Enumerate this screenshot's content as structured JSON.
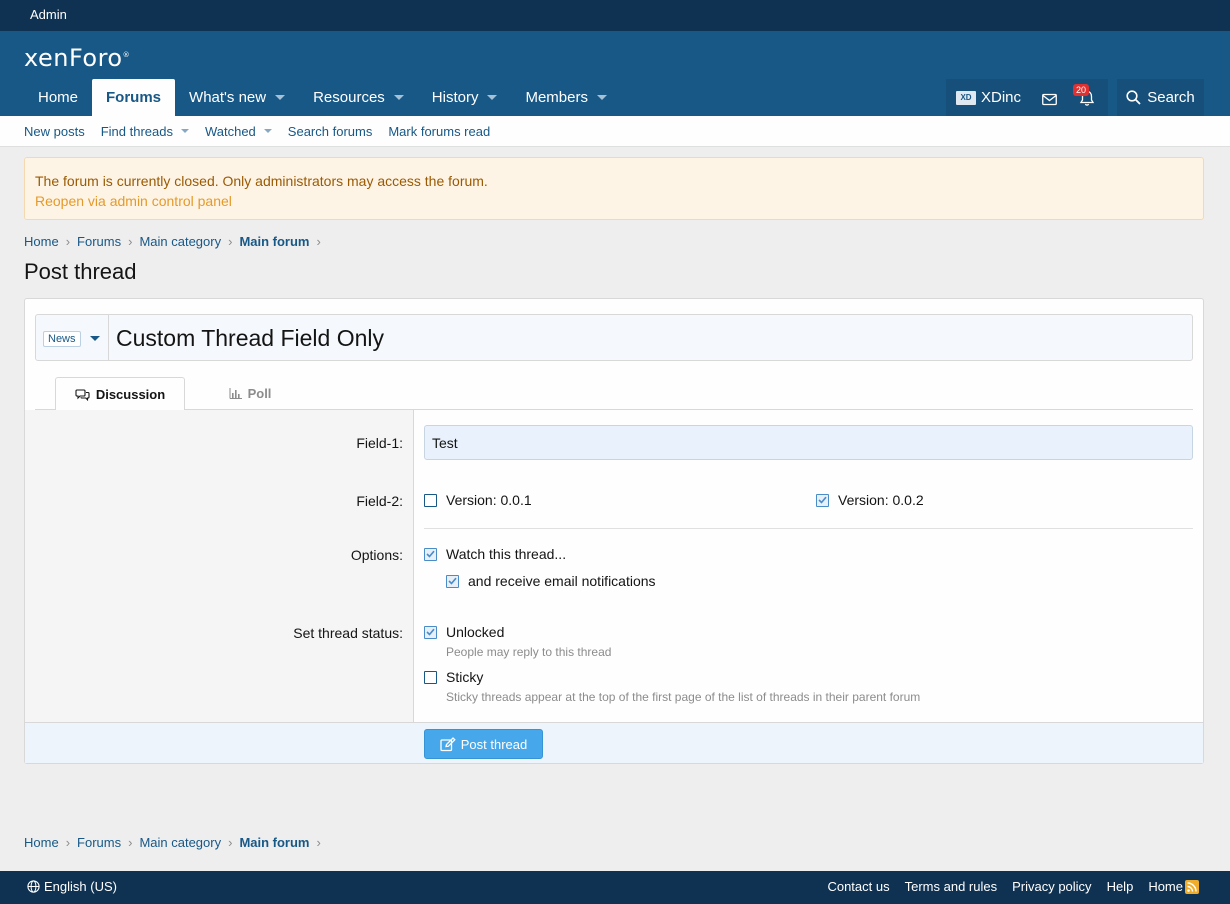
{
  "adminbar": {
    "admin_label": "Admin"
  },
  "header": {
    "logo": "xenForo",
    "logo_mark": "®",
    "nav": [
      {
        "label": "Home",
        "active": false,
        "dropdown": false
      },
      {
        "label": "Forums",
        "active": true,
        "dropdown": false
      },
      {
        "label": "What's new",
        "active": false,
        "dropdown": true
      },
      {
        "label": "Resources",
        "active": false,
        "dropdown": true
      },
      {
        "label": "History",
        "active": false,
        "dropdown": true
      },
      {
        "label": "Members",
        "active": false,
        "dropdown": true
      }
    ],
    "user": {
      "avatar_text": "XD",
      "name": "XDinc"
    },
    "alerts_count": "20",
    "search_label": "Search"
  },
  "subnav": [
    {
      "label": "New posts",
      "dropdown": false
    },
    {
      "label": "Find threads",
      "dropdown": true
    },
    {
      "label": "Watched",
      "dropdown": true
    },
    {
      "label": "Search forums",
      "dropdown": false
    },
    {
      "label": "Mark forums read",
      "dropdown": false
    }
  ],
  "notice": {
    "text": "The forum is currently closed. Only administrators may access the forum.",
    "link": "Reopen via admin control panel"
  },
  "breadcrumb": [
    "Home",
    "Forums",
    "Main category",
    "Main forum"
  ],
  "page_title": "Post thread",
  "form": {
    "prefix": "News",
    "title_value": "Custom Thread Field Only",
    "tabs": {
      "discussion": "Discussion",
      "poll": "Poll"
    },
    "field1": {
      "label": "Field-1:",
      "value": "Test"
    },
    "field2": {
      "label": "Field-2:",
      "options": [
        {
          "label": "Version: 0.0.1",
          "checked": false
        },
        {
          "label": "Version: 0.0.2",
          "checked": true
        }
      ]
    },
    "options": {
      "label": "Options:",
      "watch": "Watch this thread...",
      "email": "and receive email notifications"
    },
    "status": {
      "label": "Set thread status:",
      "unlocked": "Unlocked",
      "unlocked_hint": "People may reply to this thread",
      "sticky": "Sticky",
      "sticky_hint": "Sticky threads appear at the top of the first page of the list of threads in their parent forum"
    },
    "submit": "Post thread"
  },
  "footer": {
    "language": "English (US)",
    "links": [
      "Contact us",
      "Terms and rules",
      "Privacy policy",
      "Help",
      "Home"
    ]
  },
  "colors": {
    "header": "#185886",
    "adminbar": "#0f3252",
    "button": "#47a7eb",
    "notice_bg": "#fef4e6"
  }
}
